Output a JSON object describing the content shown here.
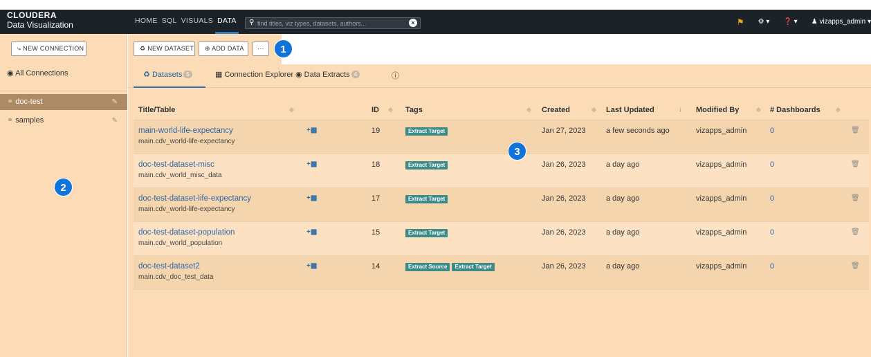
{
  "brand": {
    "name": "CLOUDERA",
    "sub": "Data Visualization"
  },
  "nav": [
    "HOME",
    "SQL",
    "VISUALS",
    "DATA"
  ],
  "search": {
    "placeholder": "find titles, viz types, datasets, authors..."
  },
  "user": {
    "name": "vizapps_admin"
  },
  "sidebar": {
    "new_connection": "NEW CONNECTION",
    "all_connections": "All Connections",
    "connections": [
      "doc-test",
      "samples"
    ]
  },
  "toolbar": {
    "new_dataset": "NEW DATASET",
    "add_data": "ADD DATA",
    "more": "···"
  },
  "callouts": [
    "1",
    "2",
    "3"
  ],
  "tabs": {
    "datasets": {
      "label": "Datasets",
      "count": "5"
    },
    "explorer": {
      "label": "Connection Explorer"
    },
    "extracts": {
      "label": "Data Extracts",
      "count": "4"
    }
  },
  "table": {
    "headers": [
      "Title/Table",
      "ID",
      "Tags",
      "Created",
      "Last Updated",
      "Modified By",
      "# Dashboards"
    ],
    "rows": [
      {
        "title": "main-world-life-expectancy",
        "table": "main.cdv_world-life-expectancy",
        "id": "19",
        "tags": [
          "Extract Target"
        ],
        "created": "Jan 27, 2023",
        "updated": "a few seconds ago",
        "modified_by": "vizapps_admin",
        "dashboards": "0"
      },
      {
        "title": "doc-test-dataset-misc",
        "table": "main.cdv_world_misc_data",
        "id": "18",
        "tags": [
          "Extract Target"
        ],
        "created": "Jan 26, 2023",
        "updated": "a day ago",
        "modified_by": "vizapps_admin",
        "dashboards": "0"
      },
      {
        "title": "doc-test-dataset-life-expectancy",
        "table": "main.cdv_world-life-expectancy",
        "id": "17",
        "tags": [
          "Extract Target"
        ],
        "created": "Jan 26, 2023",
        "updated": "a day ago",
        "modified_by": "vizapps_admin",
        "dashboards": "0"
      },
      {
        "title": "doc-test-dataset-population",
        "table": "main.cdv_world_population",
        "id": "15",
        "tags": [
          "Extract Target"
        ],
        "created": "Jan 26, 2023",
        "updated": "a day ago",
        "modified_by": "vizapps_admin",
        "dashboards": "0"
      },
      {
        "title": "doc-test-dataset2",
        "table": "main.cdv_doc_test_data",
        "id": "14",
        "tags": [
          "Extract Source",
          "Extract Target"
        ],
        "created": "Jan 26, 2023",
        "updated": "a day ago",
        "modified_by": "vizapps_admin",
        "dashboards": "0"
      }
    ]
  }
}
